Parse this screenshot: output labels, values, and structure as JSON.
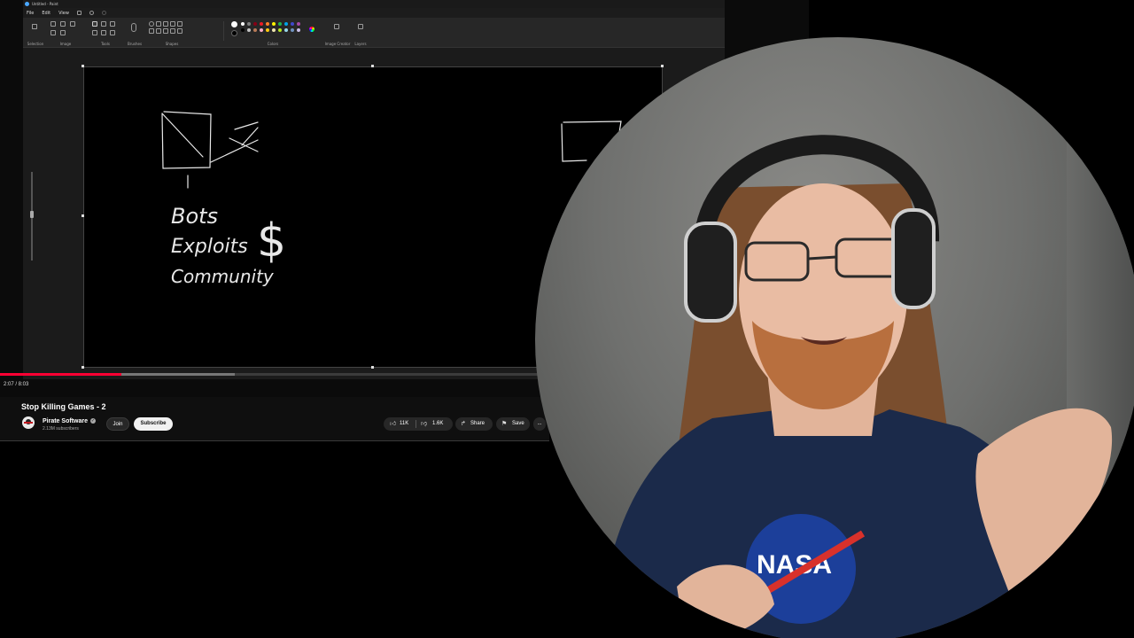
{
  "paint": {
    "title": "Untitled - Paint",
    "menu": [
      "File",
      "Edit",
      "View"
    ],
    "groups": [
      "Selection",
      "Image",
      "Tools",
      "Brushes",
      "Shapes",
      "Colors",
      "Image Creator",
      "Layers"
    ],
    "palette": [
      "#ffffff",
      "#7f7f7f",
      "#880015",
      "#ed1c24",
      "#ff7f27",
      "#fff200",
      "#22b14c",
      "#00a2e8",
      "#3f48cc",
      "#a349a4",
      "#000000",
      "#c3c3c3",
      "#b97a57",
      "#ffaec9",
      "#ffc90e",
      "#efe4b0",
      "#b5e61d",
      "#99d9ea",
      "#7092be",
      "#c8bfe7"
    ],
    "sketch_text": [
      "Bots",
      "Exploits",
      "Community",
      "$"
    ]
  },
  "player": {
    "time": "2:07 / 8:03",
    "played_fraction": 0.15,
    "buffered_fraction": 0.29
  },
  "video": {
    "title": "Stop Killing Games - 2",
    "channel": "Pirate Software",
    "subscribers": "2.13M subscribers",
    "join_label": "Join",
    "subscribe_label": "Subscribe",
    "likes": "11K",
    "dislikes": "1.6K",
    "share_label": "Share",
    "save_label": "Save",
    "more_label": "..."
  },
  "colors": {
    "accent_red": "#ff0033",
    "background": "#0f0f0f"
  }
}
